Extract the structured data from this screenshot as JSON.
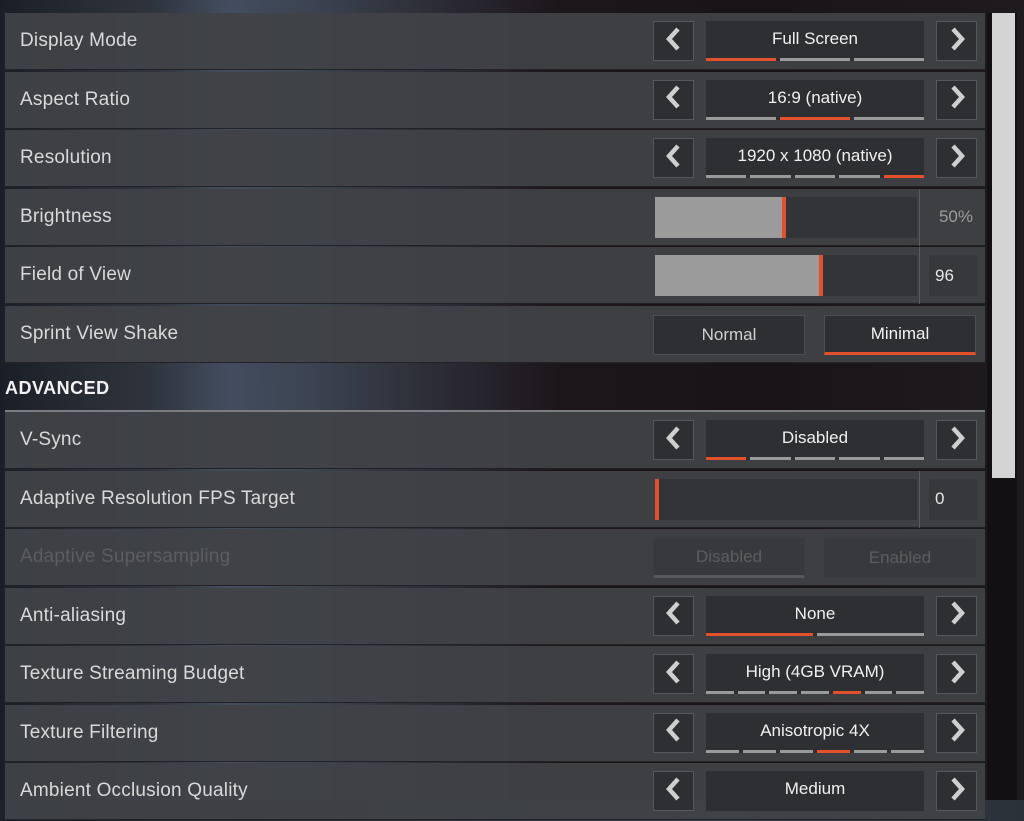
{
  "accent_color": "#e2512a",
  "rows_top": [
    {
      "type": "carousel",
      "label": "Display Mode",
      "value": "Full Screen",
      "option_count": 3,
      "selected_index": 0
    },
    {
      "type": "carousel",
      "label": "Aspect Ratio",
      "value": "16:9 (native)",
      "option_count": 3,
      "selected_index": 1
    },
    {
      "type": "carousel",
      "label": "Resolution",
      "value": "1920 x 1080 (native)",
      "option_count": 5,
      "selected_index": 4
    },
    {
      "type": "slider",
      "label": "Brightness",
      "value_text": "50%",
      "fraction": 0.5,
      "boxed": false
    },
    {
      "type": "slider",
      "label": "Field of View",
      "value_text": "96",
      "fraction": 0.64,
      "boxed": true
    },
    {
      "type": "toggle",
      "label": "Sprint View Shake",
      "options": [
        "Normal",
        "Minimal"
      ],
      "selected_index": 1,
      "disabled": false
    }
  ],
  "section": {
    "title": "ADVANCED"
  },
  "rows_advanced": [
    {
      "type": "carousel",
      "label": "V-Sync",
      "value": "Disabled",
      "option_count": 5,
      "selected_index": 0
    },
    {
      "type": "slider",
      "label": "Adaptive Resolution FPS Target",
      "value_text": "0",
      "fraction": 0.0,
      "boxed": true
    },
    {
      "type": "toggle",
      "label": "Adaptive Supersampling",
      "options": [
        "Disabled",
        "Enabled"
      ],
      "selected_index": 0,
      "disabled": true
    },
    {
      "type": "carousel",
      "label": "Anti-aliasing",
      "value": "None",
      "option_count": 2,
      "selected_index": 0
    },
    {
      "type": "carousel",
      "label": "Texture Streaming Budget",
      "value": "High (4GB VRAM)",
      "option_count": 7,
      "selected_index": 4
    },
    {
      "type": "carousel",
      "label": "Texture Filtering",
      "value": "Anisotropic 4X",
      "option_count": 6,
      "selected_index": 3
    },
    {
      "type": "carousel",
      "label": "Ambient Occlusion Quality",
      "value": "Medium",
      "option_count": 0,
      "selected_index": 0
    }
  ],
  "scrollbar": {
    "position_fraction": 0.0,
    "visible_fraction": 0.59
  }
}
